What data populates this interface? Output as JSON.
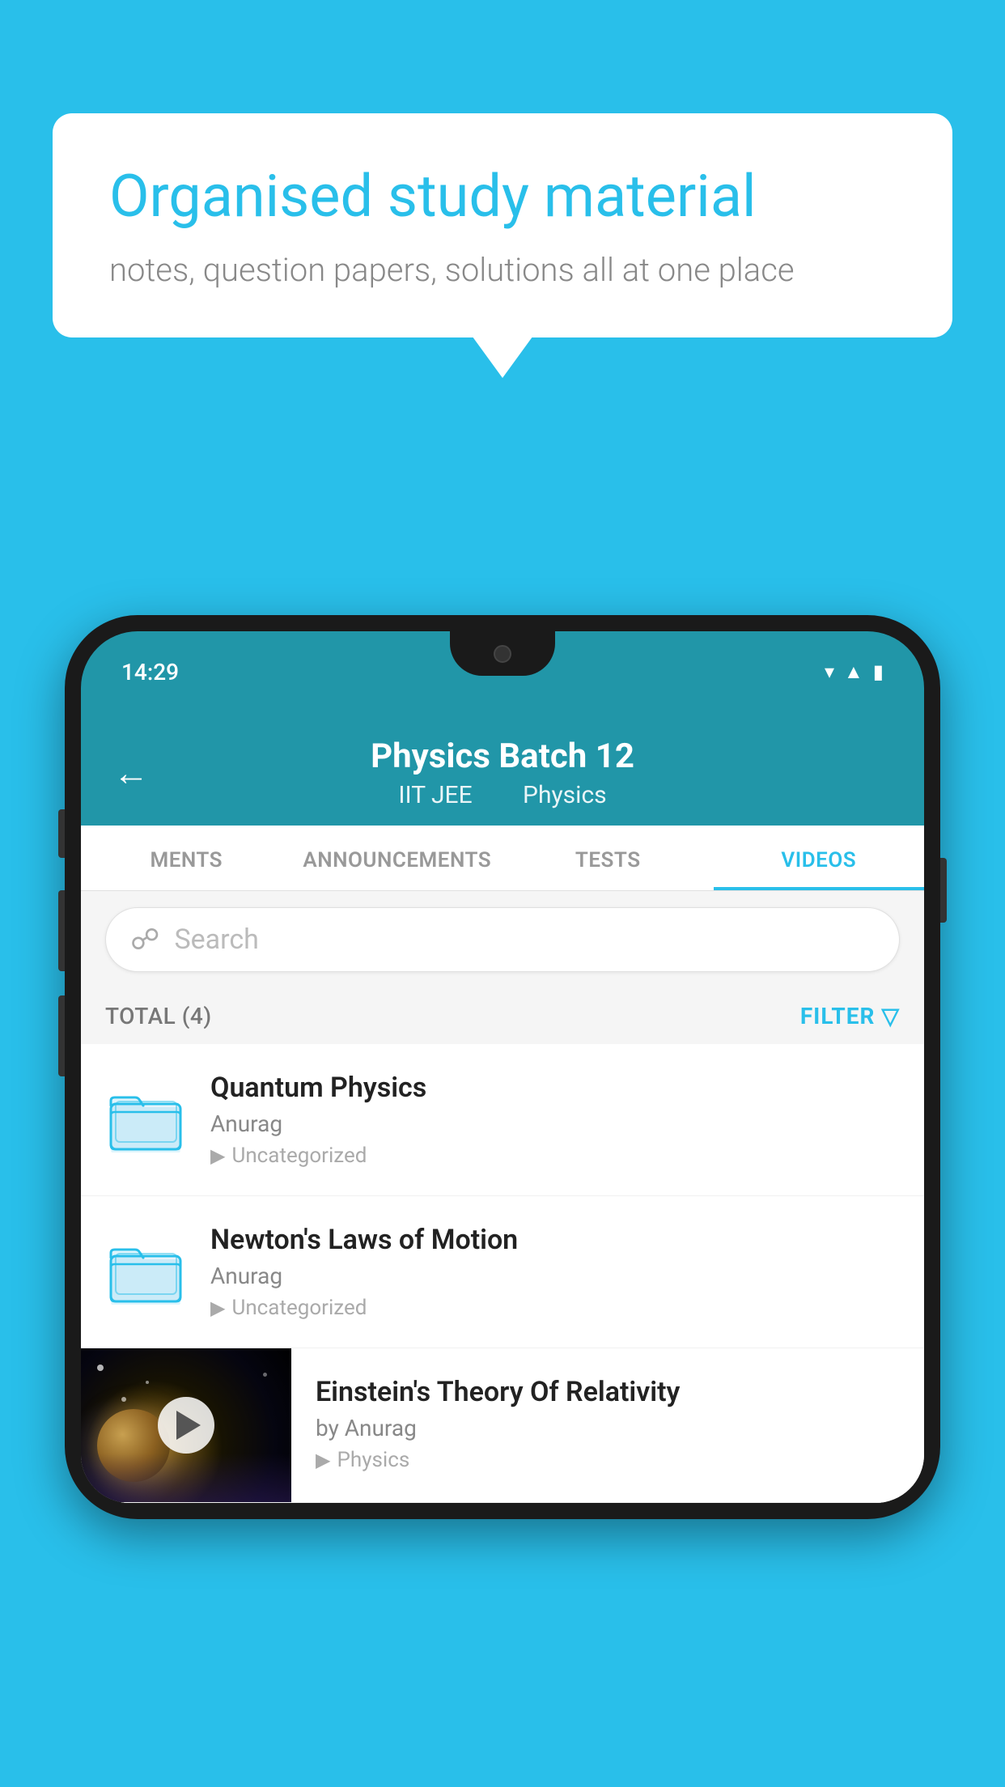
{
  "background_color": "#29BFEA",
  "bubble": {
    "title": "Organised study material",
    "subtitle": "notes, question papers, solutions all at one place"
  },
  "status_bar": {
    "time": "14:29",
    "icons": [
      "wifi",
      "signal",
      "battery"
    ]
  },
  "header": {
    "title": "Physics Batch 12",
    "subtitle_part1": "IIT JEE",
    "subtitle_part2": "Physics",
    "back_label": "←"
  },
  "tabs": [
    {
      "label": "MENTS",
      "active": false
    },
    {
      "label": "ANNOUNCEMENTS",
      "active": false
    },
    {
      "label": "TESTS",
      "active": false
    },
    {
      "label": "VIDEOS",
      "active": true
    }
  ],
  "search": {
    "placeholder": "Search"
  },
  "filter_bar": {
    "total_label": "TOTAL (4)",
    "filter_label": "FILTER"
  },
  "videos": [
    {
      "title": "Quantum Physics",
      "author": "Anurag",
      "tag": "Uncategorized",
      "type": "folder"
    },
    {
      "title": "Newton's Laws of Motion",
      "author": "Anurag",
      "tag": "Uncategorized",
      "type": "folder"
    },
    {
      "title": "Einstein's Theory Of Relativity",
      "author": "by Anurag",
      "tag": "Physics",
      "type": "video"
    }
  ]
}
